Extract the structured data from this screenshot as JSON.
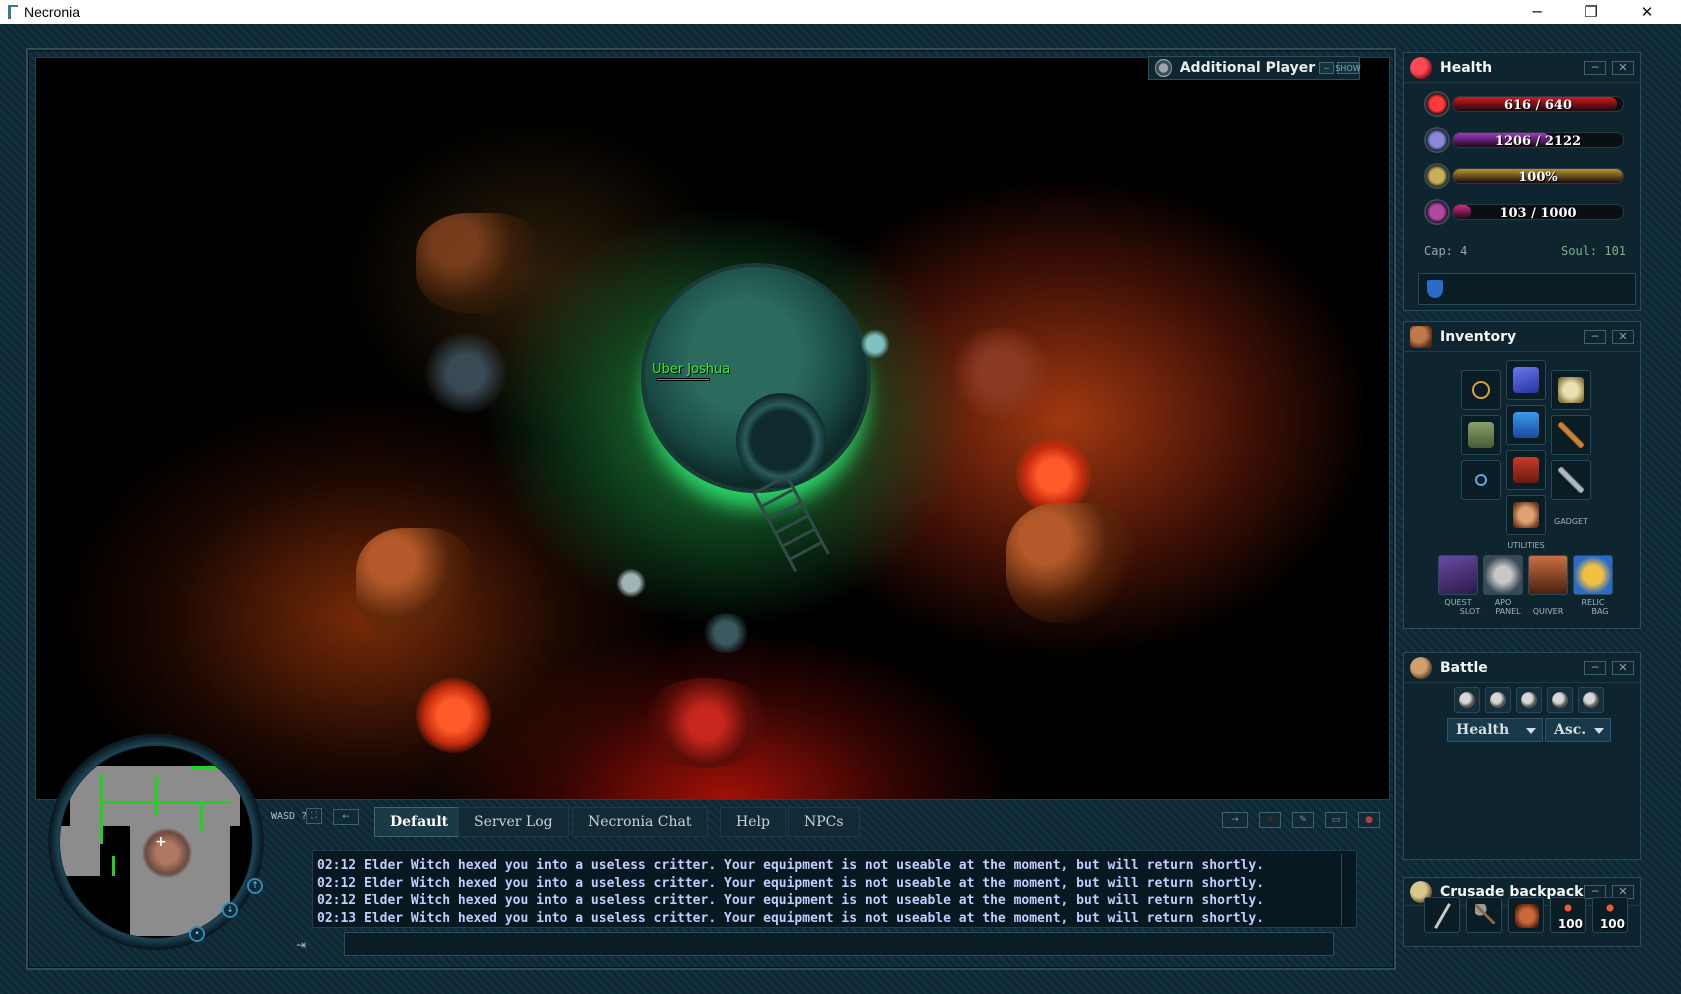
{
  "window": {
    "title": "Necronia",
    "minimize": "─",
    "restore": "❐",
    "close": "✕"
  },
  "game": {
    "player_name": "Uber Joshua"
  },
  "addl_options": {
    "label": "Additional Player Options",
    "show_label": "SHOW",
    "minimize": "─"
  },
  "health_panel": {
    "title": "Health",
    "minimize": "─",
    "close": "✕",
    "bars": [
      {
        "name": "health",
        "text": "616 / 640",
        "fraction": 0.9625,
        "color": "#d8161b"
      },
      {
        "name": "mana",
        "text": "1206 / 2122",
        "fraction": 0.5683,
        "color": "#a534c9"
      },
      {
        "name": "stamina",
        "text": "100%",
        "fraction": 1.0,
        "color": "#b8962a"
      },
      {
        "name": "experience",
        "text": "103 / 1000",
        "fraction": 0.103,
        "color": "#d6288e"
      }
    ],
    "cap": "Cap: 4",
    "soul": "Soul: 101"
  },
  "inventory_panel": {
    "title": "Inventory",
    "minimize": "─",
    "close": "✕",
    "gadget_label": "GADGET",
    "utilities_label": "UTILITIES",
    "utilities": [
      {
        "label_top": "QUEST",
        "label_bottom": "SLOT"
      },
      {
        "label_top": "APO",
        "label_bottom": "PANEL"
      },
      {
        "label_top": "",
        "label_bottom": "QUIVER"
      },
      {
        "label_top": "RELIC",
        "label_bottom": "BAG"
      }
    ]
  },
  "battle_panel": {
    "title": "Battle",
    "minimize": "─",
    "close": "✕",
    "sort_by": "Health",
    "order": "Asc."
  },
  "backpack_panel": {
    "title": "Crusade backpack",
    "minimize": "─",
    "close": "✕",
    "counts": [
      "100",
      "100"
    ]
  },
  "chat": {
    "wasd_label": "WASD ?",
    "tabs": [
      "Default",
      "Server Log",
      "Necronia Chat",
      "Help",
      "NPCs"
    ],
    "active_tab": "Default",
    "lines": [
      "02:12 Elder Witch hexed you into a useless critter. Your equipment is not useable at the moment, but will return shortly.",
      "02:12 Elder Witch hexed you into a useless critter. Your equipment is not useable at the moment, but will return shortly.",
      "02:12 Elder Witch hexed you into a useless critter. Your equipment is not useable at the moment, but will return shortly.",
      "02:13 Elder Witch hexed you into a useless critter. Your equipment is not useable at the moment, but will return shortly."
    ]
  },
  "colors": {
    "frame": "#12303d",
    "accent": "#2a8ab4",
    "chat_text": "#c4ccff",
    "name_green": "#3fe63f"
  }
}
